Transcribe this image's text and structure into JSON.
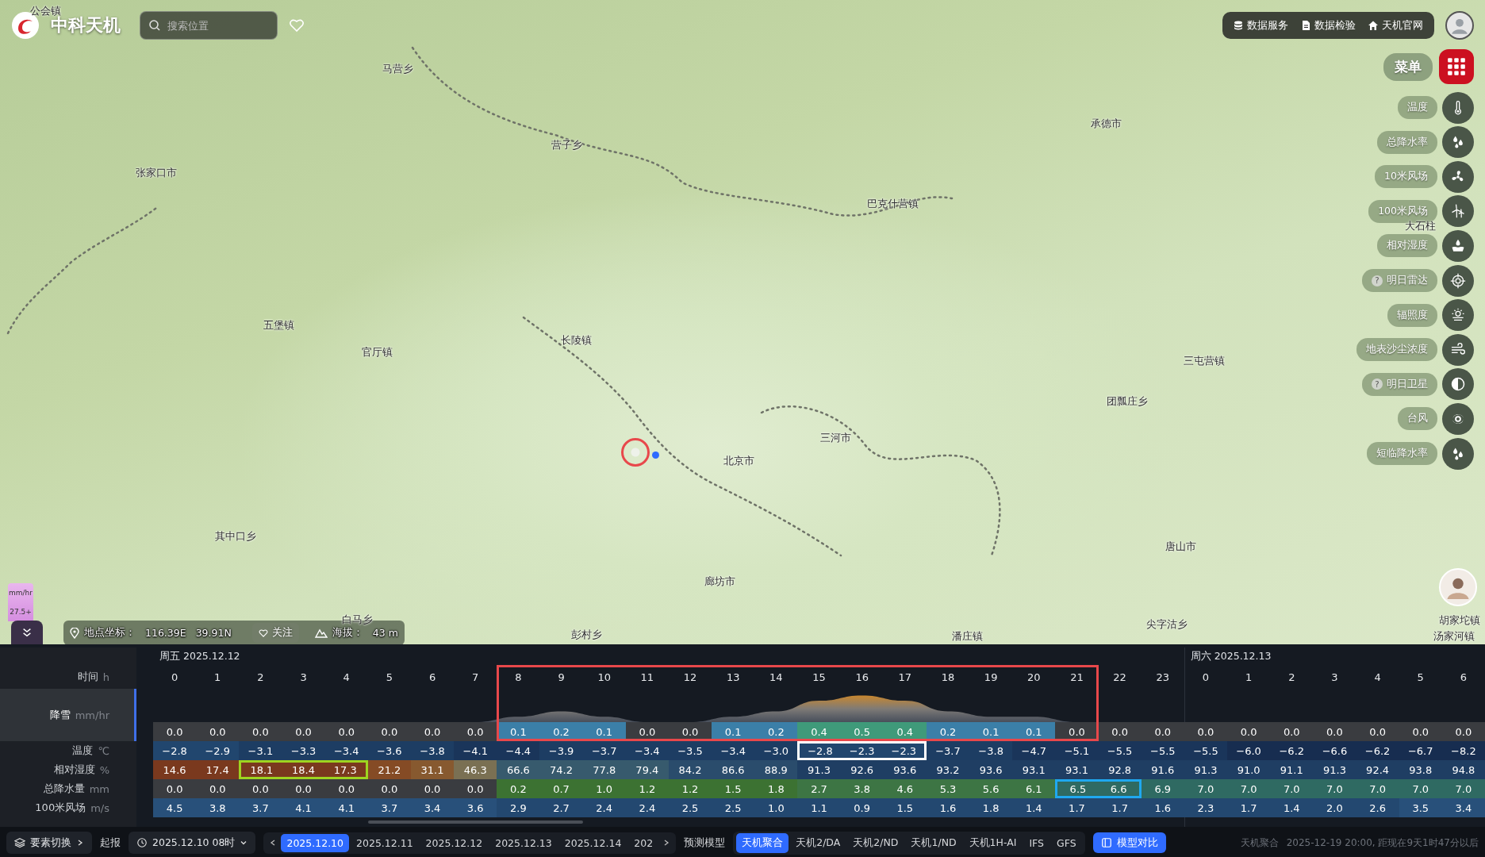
{
  "app": {
    "title": "中科天机",
    "search": {
      "placeholder": "搜索位置"
    },
    "links": [
      {
        "label": "数据服务",
        "kind": "database"
      },
      {
        "label": "数据检验",
        "kind": "document"
      },
      {
        "label": "天机官网",
        "kind": "home"
      }
    ]
  },
  "map": {
    "labels": [
      "公会镇",
      "马营乡",
      "营子乡",
      "张家口市",
      "承德市",
      "巴克什营镇",
      "五堡镇",
      "长陵镇",
      "官厅镇",
      "三屯营镇",
      "团瓢庄乡",
      "三河市",
      "北京市",
      "其中口乡",
      "唐山市",
      "廊坊市",
      "白马乡",
      "彭村乡",
      "潘庄镇",
      "尖字沽乡",
      "胡家坨镇",
      "汤家河镇",
      "大石柱"
    ]
  },
  "menu": {
    "label": "菜单",
    "layers": [
      {
        "label": "温度",
        "kind": "thermometer"
      },
      {
        "label": "总降水率",
        "kind": "drops"
      },
      {
        "label": "10米风场",
        "kind": "fan"
      },
      {
        "label": "100米风场",
        "kind": "turbine"
      },
      {
        "label": "相对湿度",
        "kind": "humidity"
      },
      {
        "label": "明日雷达",
        "kind": "radar",
        "help_badge": "?"
      },
      {
        "label": "辐照度",
        "kind": "sun"
      },
      {
        "label": "地表沙尘浓度",
        "kind": "wind"
      },
      {
        "label": "明日卫星",
        "kind": "contrast",
        "help_badge": "?"
      },
      {
        "label": "台风",
        "kind": "typhoon"
      },
      {
        "label": "短临降水率",
        "kind": "drops"
      }
    ]
  },
  "legend": {
    "unit": "mm/hr",
    "max": "27.5+"
  },
  "location": {
    "coord_label": "地点坐标：",
    "lon": "116.39E",
    "lat": "39.91N",
    "follow": "关注",
    "elev_label": "海拔：",
    "elev": "43 m"
  },
  "forecast": {
    "hours": [
      {
        "label": "0",
        "day": "周五 2025.12.12",
        "outlined": false
      },
      {
        "label": "1",
        "outlined": false
      },
      {
        "label": "2",
        "outlined": false
      },
      {
        "label": "3",
        "outlined": false
      },
      {
        "label": "4",
        "outlined": false
      },
      {
        "label": "5",
        "outlined": false
      },
      {
        "label": "6",
        "outlined": false
      },
      {
        "label": "7",
        "outlined": false
      },
      {
        "label": "8",
        "outlined": true
      },
      {
        "label": "9",
        "outlined": true
      },
      {
        "label": "10",
        "outlined": true
      },
      {
        "label": "11",
        "outlined": true
      },
      {
        "label": "12",
        "outlined": true
      },
      {
        "label": "13",
        "outlined": true
      },
      {
        "label": "14",
        "outlined": true
      },
      {
        "label": "15",
        "outlined": true
      },
      {
        "label": "16",
        "outlined": true
      },
      {
        "label": "17",
        "outlined": true
      },
      {
        "label": "18",
        "outlined": true
      },
      {
        "label": "19",
        "outlined": true
      },
      {
        "label": "20",
        "outlined": true
      },
      {
        "label": "21",
        "outlined": true
      },
      {
        "label": "22",
        "outlined": false
      },
      {
        "label": "23",
        "outlined": false
      },
      {
        "label": "0",
        "day": "周六 2025.12.13",
        "outlined": false
      },
      {
        "label": "1",
        "outlined": false
      },
      {
        "label": "2",
        "outlined": false
      },
      {
        "label": "3",
        "outlined": false
      },
      {
        "label": "4",
        "outlined": false
      },
      {
        "label": "5",
        "outlined": false
      },
      {
        "label": "6",
        "outlined": false
      }
    ],
    "time_label": "时间",
    "time_unit": "h",
    "rows": [
      {
        "kind": "snow",
        "label": "降雪",
        "unit": "mm/hr",
        "selected": true,
        "values": [
          "0.0",
          "0.0",
          "0.0",
          "0.0",
          "0.0",
          "0.0",
          "0.0",
          "0.0",
          "0.1",
          "0.2",
          "0.1",
          "0.0",
          "0.0",
          "0.1",
          "0.2",
          "0.4",
          "0.5",
          "0.4",
          "0.2",
          "0.1",
          "0.1",
          "0.0",
          "0.0",
          "0.0",
          "0.0",
          "0.0",
          "0.0",
          "0.0",
          "0.0",
          "0.0",
          "0.0"
        ]
      },
      {
        "kind": "temp",
        "label": "温度",
        "unit": "℃",
        "selected": false,
        "values": [
          "−2.8",
          "−2.9",
          "−3.1",
          "−3.3",
          "−3.4",
          "−3.6",
          "−3.8",
          "−4.1",
          "−4.4",
          "−3.9",
          "−3.7",
          "−3.4",
          "−3.5",
          "−3.4",
          "−3.0",
          "−2.8",
          "−2.3",
          "−2.3",
          "−3.7",
          "−3.8",
          "−4.7",
          "−5.1",
          "−5.5",
          "−5.5",
          "−5.5",
          "−6.0",
          "−6.2",
          "−6.6",
          "−6.2",
          "−6.7",
          "−8.2"
        ],
        "outlined": [
          false,
          false,
          false,
          false,
          false,
          false,
          false,
          false,
          false,
          false,
          false,
          false,
          false,
          false,
          false,
          true,
          true,
          true,
          false,
          false,
          false,
          false,
          false,
          false,
          false,
          false,
          false,
          false,
          false,
          false,
          false
        ]
      },
      {
        "kind": "humidity",
        "label": "相对湿度",
        "unit": "%",
        "selected": false,
        "values": [
          "14.6",
          "17.4",
          "18.1",
          "18.4",
          "17.3",
          "21.2",
          "31.1",
          "46.3",
          "66.6",
          "74.2",
          "77.8",
          "79.4",
          "84.2",
          "86.6",
          "88.9",
          "91.3",
          "92.6",
          "93.6",
          "93.2",
          "93.6",
          "93.1",
          "93.1",
          "92.8",
          "91.6",
          "91.3",
          "91.0",
          "91.1",
          "91.3",
          "92.4",
          "93.8",
          "94.8"
        ],
        "outlined": [
          false,
          false,
          true,
          true,
          true,
          false,
          false,
          false,
          false,
          false,
          false,
          false,
          false,
          false,
          false,
          false,
          false,
          false,
          false,
          false,
          false,
          false,
          false,
          false,
          false,
          false,
          false,
          false,
          false,
          false,
          false
        ]
      },
      {
        "kind": "precip",
        "label": "总降水量",
        "unit": "mm",
        "selected": false,
        "values": [
          "0.0",
          "0.0",
          "0.0",
          "0.0",
          "0.0",
          "0.0",
          "0.0",
          "0.0",
          "0.2",
          "0.7",
          "1.0",
          "1.2",
          "1.2",
          "1.5",
          "1.8",
          "2.7",
          "3.8",
          "4.6",
          "5.3",
          "5.6",
          "6.1",
          "6.5",
          "6.6",
          "6.9",
          "7.0",
          "7.0",
          "7.0",
          "7.0",
          "7.0",
          "7.0",
          "7.0"
        ],
        "outlined": [
          false,
          false,
          false,
          false,
          false,
          false,
          false,
          false,
          false,
          false,
          false,
          false,
          false,
          false,
          false,
          false,
          false,
          false,
          false,
          false,
          false,
          true,
          true,
          false,
          false,
          false,
          false,
          false,
          false,
          false,
          false
        ]
      },
      {
        "kind": "wind",
        "label": "100米风场",
        "unit": "m/s",
        "selected": false,
        "values": [
          "4.5",
          "3.8",
          "3.7",
          "4.1",
          "4.1",
          "3.7",
          "3.4",
          "3.6",
          "2.9",
          "2.7",
          "2.4",
          "2.4",
          "2.5",
          "2.5",
          "1.0",
          "1.1",
          "0.9",
          "1.5",
          "1.6",
          "1.8",
          "1.4",
          "1.7",
          "1.7",
          "1.6",
          "2.3",
          "1.7",
          "1.4",
          "2.0",
          "2.6",
          "3.5",
          "3.4"
        ]
      }
    ]
  },
  "bottom": {
    "element_switch": "要素切换",
    "start_label": "起报",
    "start_time": "2025.12.10 08时",
    "dates": [
      {
        "label": "2025.12.10",
        "selected": true
      },
      {
        "label": "2025.12.11",
        "selected": false
      },
      {
        "label": "2025.12.12",
        "selected": false
      },
      {
        "label": "2025.12.13",
        "selected": false
      },
      {
        "label": "2025.12.14",
        "selected": false
      },
      {
        "label": "202",
        "selected": false
      }
    ],
    "model_label": "预测模型",
    "models": [
      {
        "label": "天机聚合",
        "selected": true
      },
      {
        "label": "天机2/DA",
        "selected": false
      },
      {
        "label": "天机2/ND",
        "selected": false
      },
      {
        "label": "天机1/ND",
        "selected": false
      },
      {
        "label": "天机1H-AI",
        "selected": false
      },
      {
        "label": "IFS",
        "selected": false
      },
      {
        "label": "GFS",
        "selected": false
      }
    ],
    "compare": "模型对比",
    "status_model": "天机聚合",
    "status_time": "2025-12-19  20:00, 距现在9天1时47分以后"
  }
}
